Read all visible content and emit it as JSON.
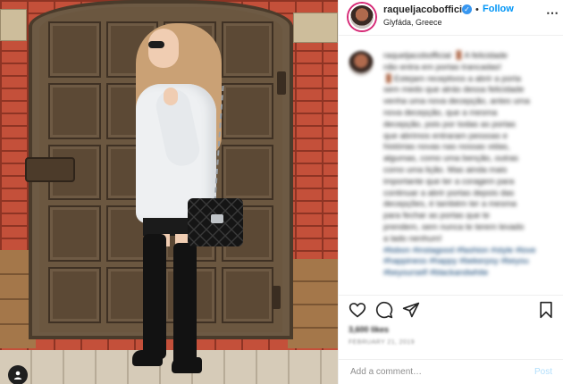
{
  "post": {
    "username": "raqueljacobofficial",
    "verified_badge": "✓",
    "separator": "•",
    "follow_label": "Follow",
    "location": "Glyfáda, Greece",
    "more_icon": "more-options-icon",
    "caption_lines": [
      "raqueljacobofficial 🚪A felicidade",
      "não entra em portas trancadas!",
      "🚪Estejam receptivos a abrir a porta",
      "sem medo que atrás dessa felicidade",
      "venha uma nova decepção, antes uma",
      "nova decepção, que a mesma",
      "decepção, pois por todas as portas",
      "que abrimos entraram pessoas e",
      "histórias novas nas nossas vidas,",
      "algumas, como uma benção, outras",
      "como uma lição. Mas ainda mais",
      "importante que ter a coragem para",
      "continuar a abrir portas depois das",
      "decepções, é também ter a mesma",
      "para fechar as portas que te",
      "prendem, sem nunca te terem levado",
      "a lado nenhum!"
    ],
    "caption_tags": "#lisbon #instagood #fashion #style #love #happiness #happy #bekerpsy #beyou #beyourself #blackandwhite",
    "likes": "3,600 likes",
    "date": "FEBRUARY 21, 2019",
    "comment_placeholder": "Add a comment…",
    "post_label": "Post"
  },
  "icons": {
    "like": "heart-icon",
    "comment": "comment-bubble-icon",
    "share": "paper-plane-icon",
    "save": "bookmark-icon",
    "photo_tag": "user-tag-icon"
  },
  "colors": {
    "link_blue": "#0095f6",
    "post_disabled": "#b2dffc",
    "text": "#262626",
    "muted": "#8e8e8e",
    "border": "#efefef"
  }
}
